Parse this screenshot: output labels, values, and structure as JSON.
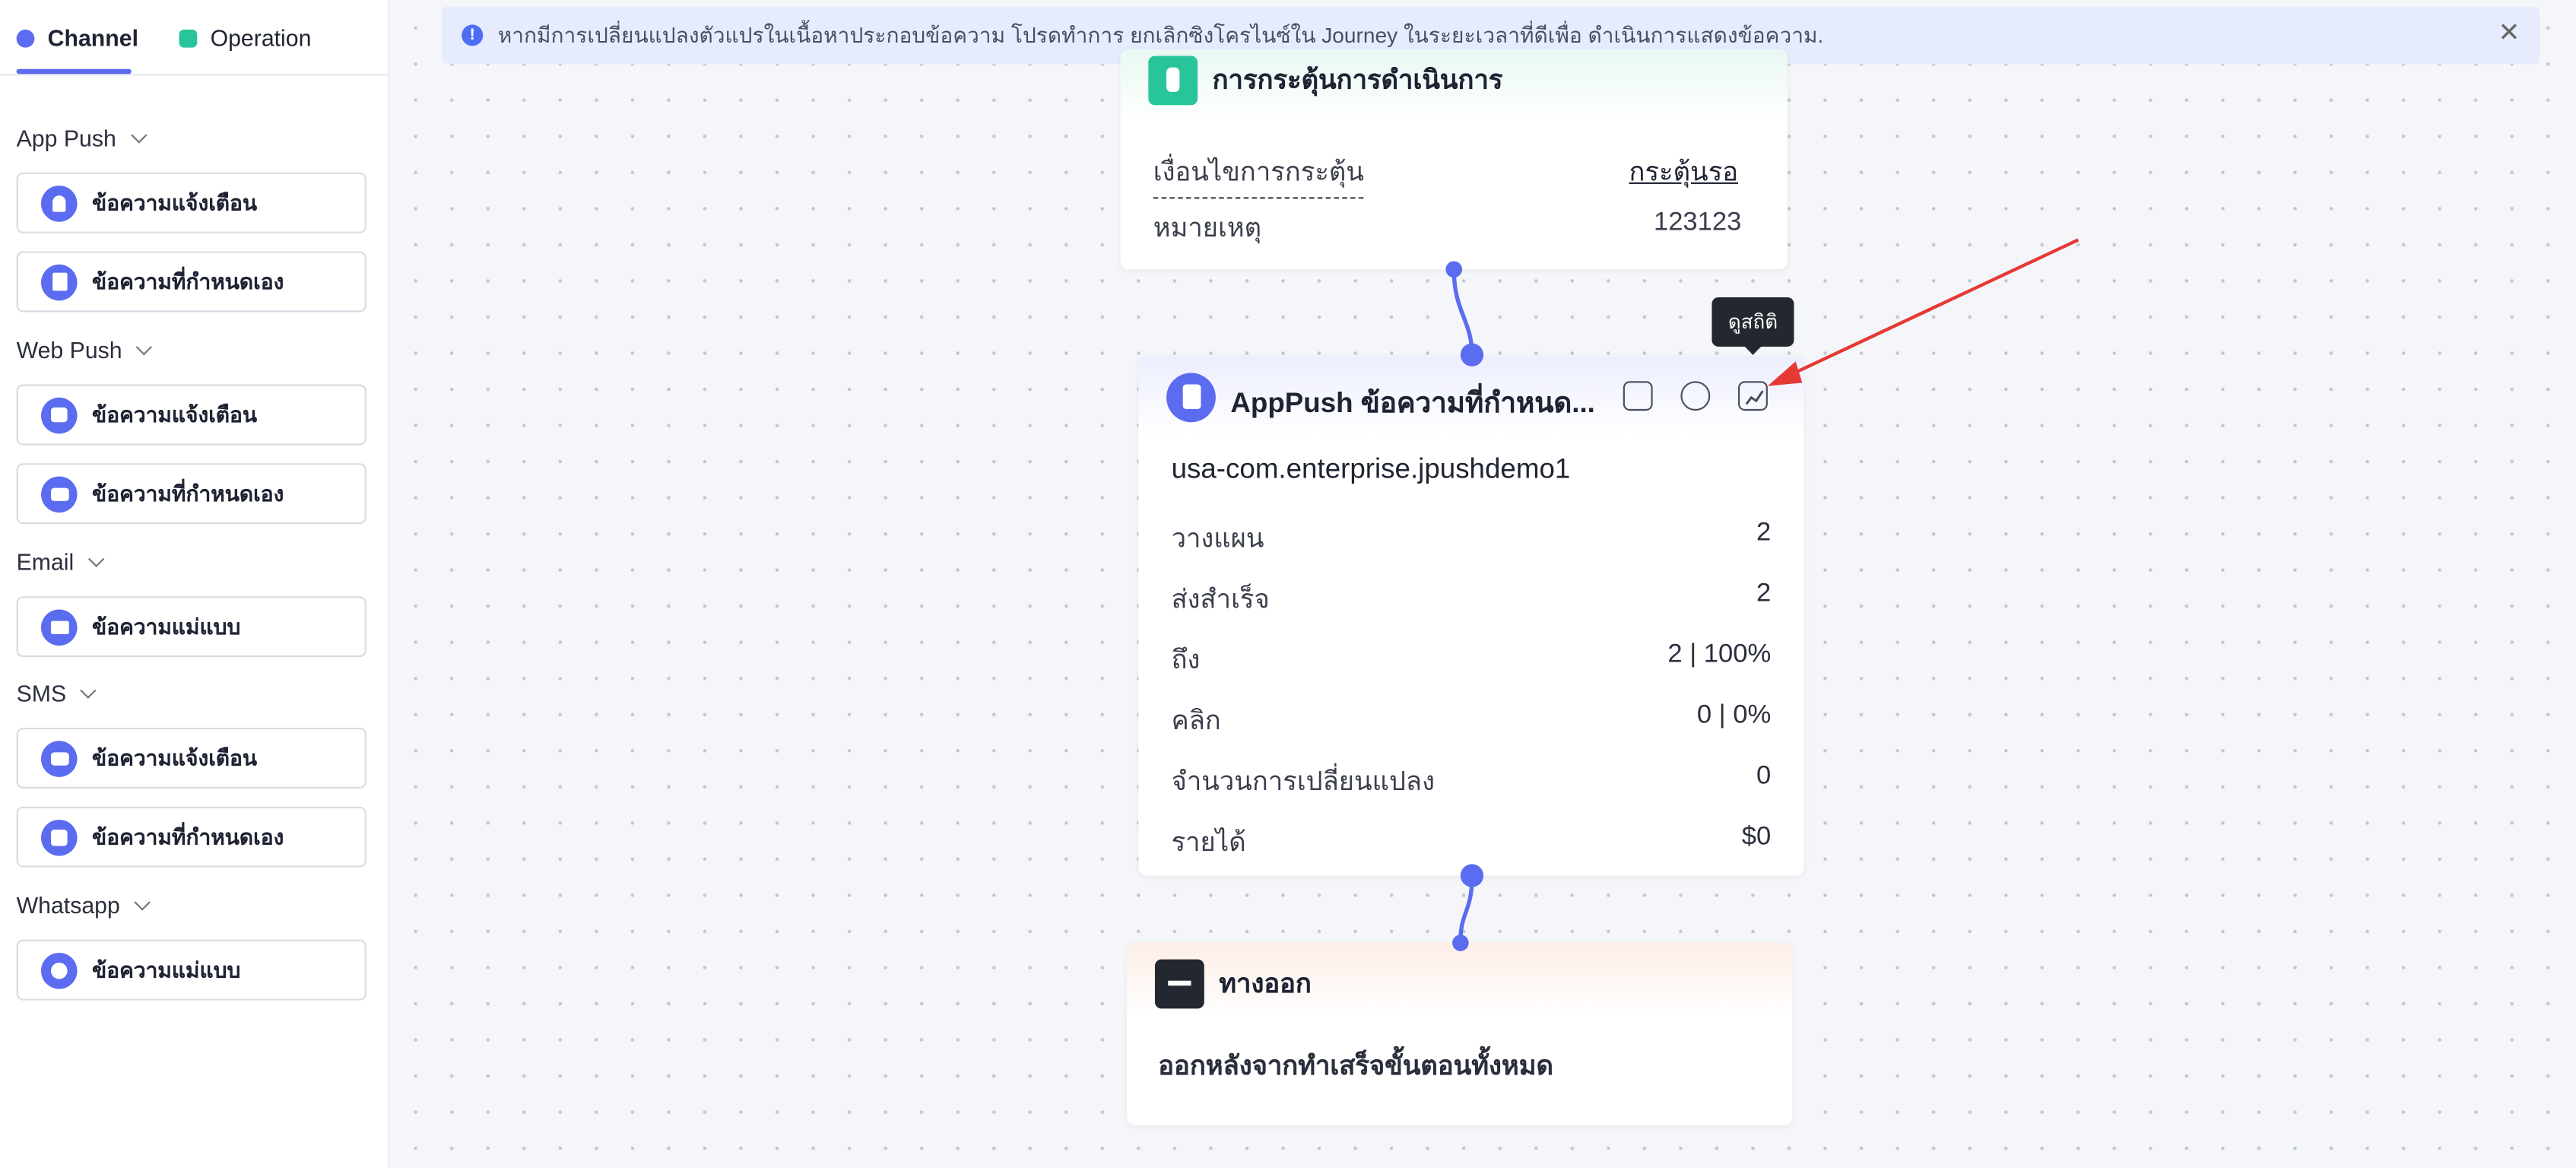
{
  "tabs": {
    "channel": "Channel",
    "operation": "Operation"
  },
  "sidebar": {
    "sections": [
      {
        "title": "App Push",
        "items": [
          "ข้อความแจ้งเตือน",
          "ข้อความที่กำหนดเอง"
        ]
      },
      {
        "title": "Web Push",
        "items": [
          "ข้อความแจ้งเตือน",
          "ข้อความที่กำหนดเอง"
        ]
      },
      {
        "title": "Email",
        "items": [
          "ข้อความแม่แบบ"
        ]
      },
      {
        "title": "SMS",
        "items": [
          "ข้อความแจ้งเตือน",
          "ข้อความที่กำหนดเอง"
        ]
      },
      {
        "title": "Whatsapp",
        "items": [
          "ข้อความแม่แบบ"
        ]
      }
    ]
  },
  "banner": {
    "text": "หากมีการเปลี่ยนแปลงตัวแปรในเนื้อหาประกอบข้อความ โปรดทำการ ยกเลิกซิงโครไนซ์ใน Journey ในระยะเวลาที่ดีเพื่อ ดำเนินการแสดงข้อความ."
  },
  "trigger_card": {
    "title": "การกระตุ้นการดำเนินการ",
    "condition_label": "เงื่อนไขการกระตุ้น",
    "condition_value": "กระตุ้นรอ",
    "note_label": "หมายเหตุ",
    "note_value": "123123"
  },
  "push_card": {
    "title": "AppPush ข้อความที่กำหนด...",
    "app": "usa-com.enterprise.jpushdemo1",
    "tooltip": "ดูสถิติ",
    "rows": [
      {
        "label": "วางแผน",
        "value": "2"
      },
      {
        "label": "ส่งสำเร็จ",
        "value": "2"
      },
      {
        "label": "ถึง",
        "value": "2 | 100%"
      },
      {
        "label": "คลิก",
        "value": "0 | 0%"
      },
      {
        "label": "จำนวนการเปลี่ยนแปลง",
        "value": "0"
      },
      {
        "label": "รายได้",
        "value": "$0"
      }
    ]
  },
  "exit_card": {
    "title": "ทางออก",
    "subtitle": "ออกหลังจากทำเสร็จขั้นตอนทั้งหมด"
  },
  "colors": {
    "accent": "#5b6cf0",
    "operation": "#29c59a",
    "annotation_arrow": "#e53935"
  }
}
